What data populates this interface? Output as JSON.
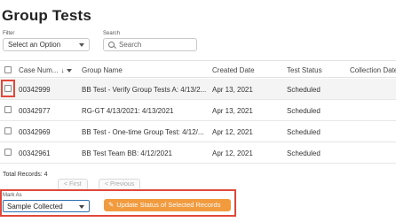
{
  "page": {
    "title": "Group Tests"
  },
  "filter": {
    "label": "Filter",
    "value": "Select an Option"
  },
  "search": {
    "label": "Search",
    "placeholder": "Search"
  },
  "table": {
    "headers": {
      "case_number": "Case Num...",
      "sort_arrow": "↓",
      "group_name": "Group Name",
      "created_date": "Created Date",
      "test_status": "Test Status",
      "collection_date": "Collection Date"
    },
    "rows": [
      {
        "case_number": "00342999",
        "group_name": "BB Test - Verify Group Tests A: 4/13/2...",
        "created_date": "Apr 13, 2021",
        "test_status": "Scheduled"
      },
      {
        "case_number": "00342977",
        "group_name": "RG-GT 4/13/2021: 4/13/2021",
        "created_date": "Apr 13, 2021",
        "test_status": "Scheduled"
      },
      {
        "case_number": "00342969",
        "group_name": "BB Test - One-time Group Test: 4/12/...",
        "created_date": "Apr 12, 2021",
        "test_status": "Scheduled"
      },
      {
        "case_number": "00342961",
        "group_name": "BB Test Team BB: 4/12/2021",
        "created_date": "Apr 12, 2021",
        "test_status": "Scheduled"
      }
    ]
  },
  "footer": {
    "total_records": "Total Records: 4",
    "first": "< First",
    "previous": "< Previous"
  },
  "mark_as": {
    "label": "Mark As",
    "value": "Sample Collected"
  },
  "update_button": {
    "icon": "✎",
    "label": "Update Status of Selected Records"
  },
  "colors": {
    "accent": "#f19a3e",
    "highlight_box": "#e0483a",
    "select_focus": "#2d6fb3"
  }
}
